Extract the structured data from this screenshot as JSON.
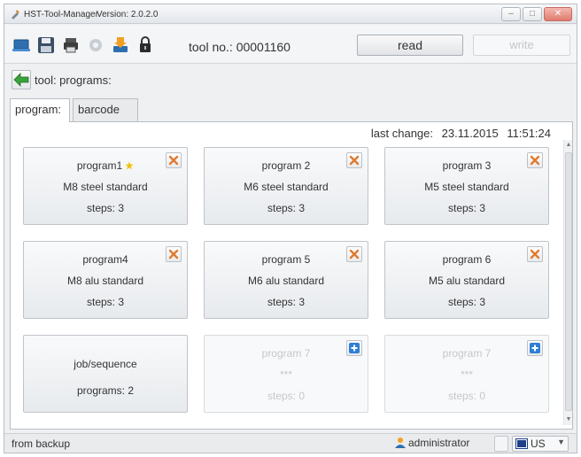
{
  "window": {
    "title": "HST-Tool-Manager",
    "version": "Version: 2.0.2.0",
    "controls": {
      "minimize": "–",
      "maximize": "□",
      "close": "✕"
    }
  },
  "toolbar": {
    "icons": [
      "laptop-icon",
      "save-icon",
      "printer-icon",
      "settings-icon",
      "sort-icon",
      "lock-icon"
    ],
    "tool_no_label": "tool no.: 00001160",
    "read_label": "read",
    "write_label": "write"
  },
  "breadcrumb": {
    "label": "tool: programs:"
  },
  "tabs": [
    {
      "label": "program:",
      "active": true
    },
    {
      "label": "barcode",
      "active": false
    }
  ],
  "last_change": {
    "label": "last change:",
    "date": "23.11.2015",
    "time": "11:51:24"
  },
  "cards": [
    {
      "name": "program1",
      "desc": "M8 steel standard",
      "steps": "steps: 3",
      "state": "filled",
      "favorite": true,
      "action": "delete"
    },
    {
      "name": "program 2",
      "desc": "M6 steel standard",
      "steps": "steps: 3",
      "state": "filled",
      "favorite": false,
      "action": "delete"
    },
    {
      "name": "program 3",
      "desc": "M5 steel standard",
      "steps": "steps: 3",
      "state": "filled",
      "favorite": false,
      "action": "delete"
    },
    {
      "name": "program4",
      "desc": "M8 alu standard",
      "steps": "steps: 3",
      "state": "filled",
      "favorite": false,
      "action": "delete"
    },
    {
      "name": "program 5",
      "desc": "M6 alu standard",
      "steps": "steps: 3",
      "state": "filled",
      "favorite": false,
      "action": "delete"
    },
    {
      "name": "program 6",
      "desc": "M5 alu standard",
      "steps": "steps: 3",
      "state": "filled",
      "favorite": false,
      "action": "delete"
    },
    {
      "name": "job/sequence",
      "desc": "programs: 2",
      "steps": "",
      "state": "job",
      "favorite": false,
      "action": "none"
    },
    {
      "name": "program 7",
      "desc": "***",
      "steps": "steps: 0",
      "state": "empty",
      "favorite": false,
      "action": "add"
    },
    {
      "name": "program 7",
      "desc": "***",
      "steps": "steps: 0",
      "state": "empty",
      "favorite": false,
      "action": "add"
    }
  ],
  "status": {
    "left": "from backup",
    "user": "administrator",
    "language": "US"
  },
  "colors": {
    "delete_x": "#e07a2e",
    "add_plus": "#2f7fd6",
    "star": "#f2c10f",
    "back_arrow": "#3aa23a"
  }
}
